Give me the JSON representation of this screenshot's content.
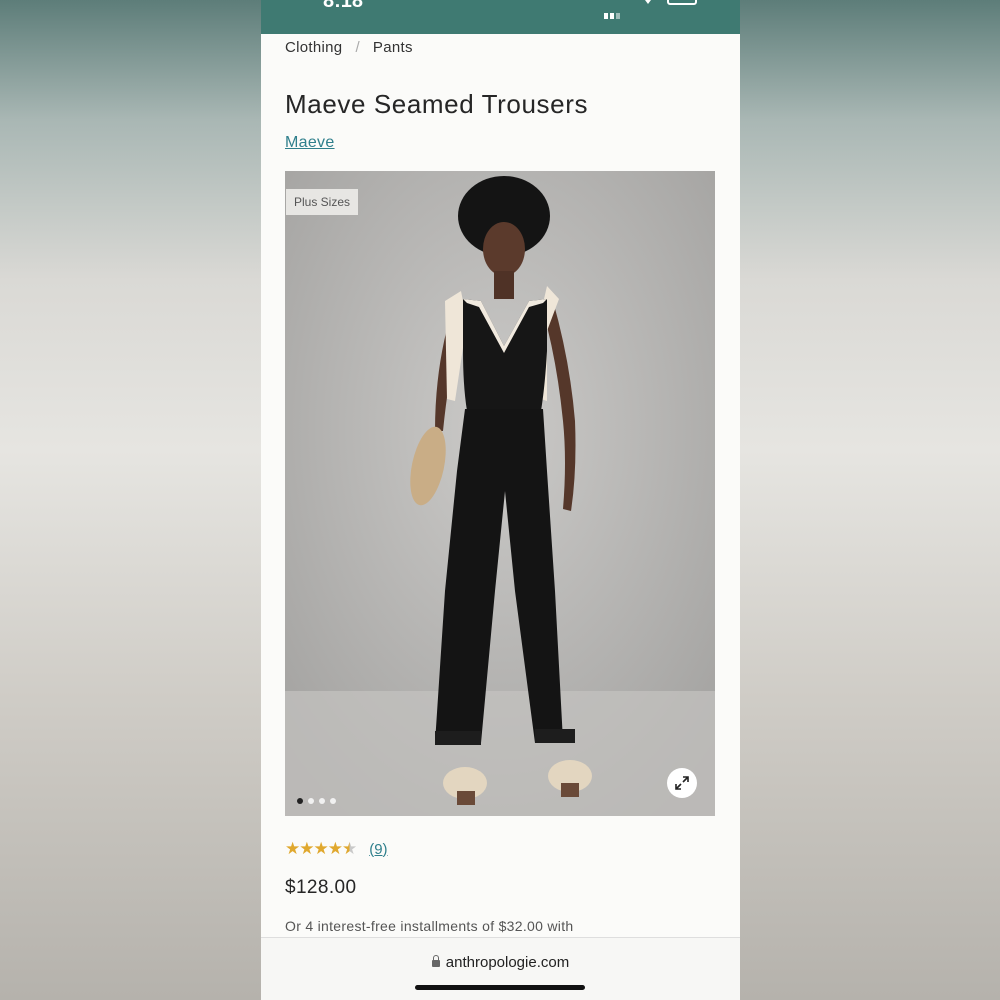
{
  "status_bar": {
    "time": "8:18",
    "background_color": "#3f7a72"
  },
  "breadcrumb": {
    "items": [
      "Clothing",
      "Pants"
    ],
    "separator": "/"
  },
  "product": {
    "title": "Maeve Seamed Trousers",
    "brand": "Maeve",
    "badge": "Plus Sizes",
    "image_count": 4,
    "active_image_index": 0,
    "rating_value": 4.5,
    "rating_max": 5,
    "review_count": "(9)",
    "price": "$128.00",
    "installments_text": "Or 4 interest-free installments of $32.00 with"
  },
  "icons": {
    "expand": "expand-arrows-icon",
    "lock": "lock-icon",
    "signal": "signal-icon",
    "wifi": "wifi-icon",
    "battery": "battery-icon"
  },
  "browser": {
    "url": "anthropologie.com"
  },
  "colors": {
    "link": "#2f7f8c",
    "star": "#e0a82e"
  }
}
